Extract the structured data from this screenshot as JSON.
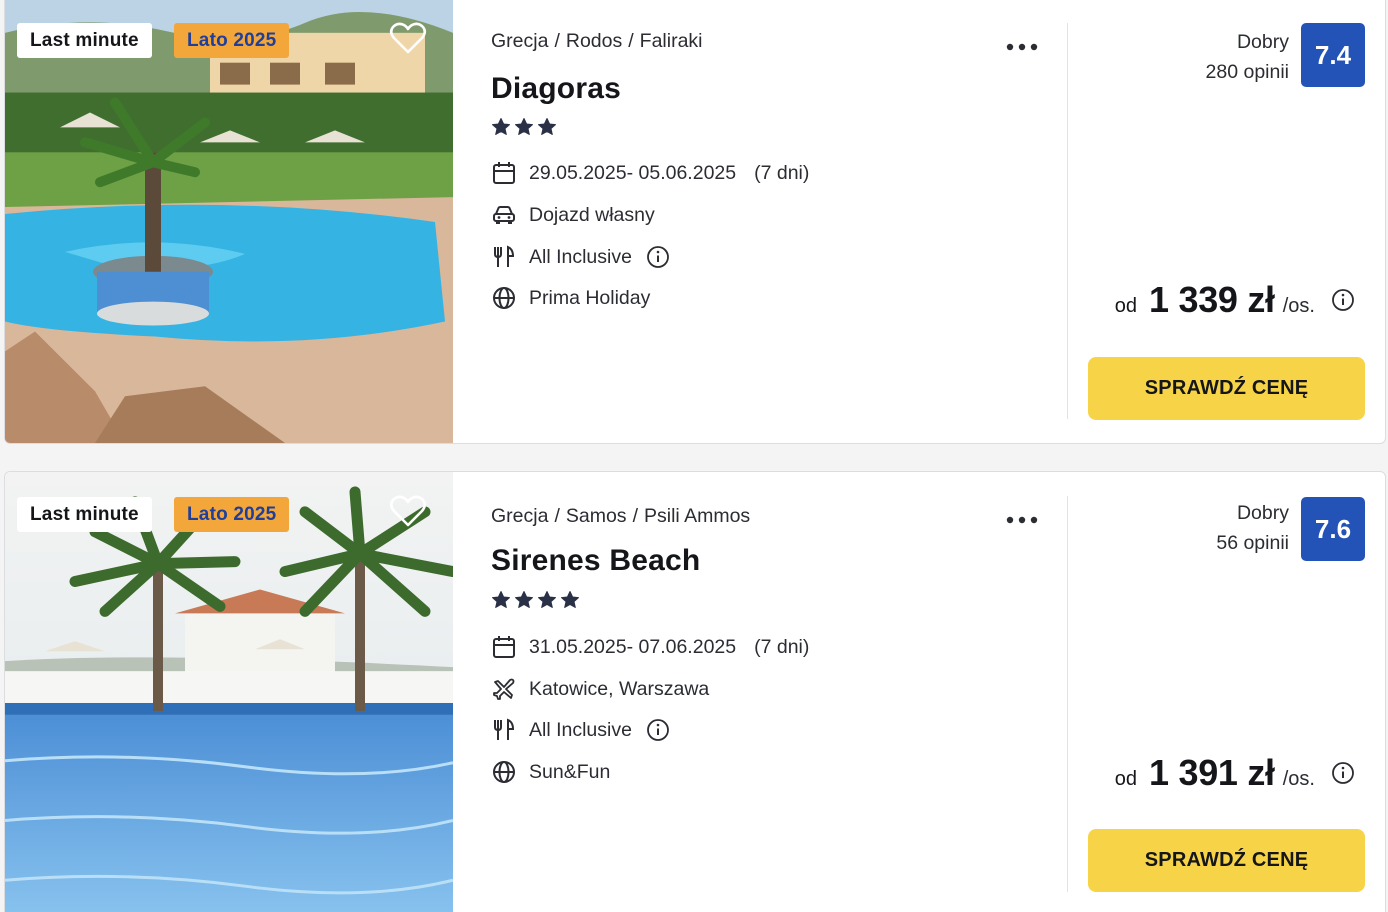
{
  "offers": [
    {
      "badges": {
        "last_minute": "Last minute",
        "season": "Lato 2025"
      },
      "breadcrumb": [
        "Grecja",
        "Rodos",
        "Faliraki"
      ],
      "breadcrumb_separator": "/",
      "name": "Diagoras",
      "stars": 3,
      "dates": "29.05.2025- 05.06.2025",
      "duration": "(7 dni)",
      "transport": "Dojazd własny",
      "transport_icon": "car-icon",
      "board": "All Inclusive",
      "operator": "Prima Holiday",
      "rating_label": "Dobry",
      "reviews": "280 opinii",
      "score": "7.4",
      "price_prefix": "od",
      "price": "1 339 zł",
      "price_unit": "/os.",
      "cta": "SPRAWDŹ CENĘ"
    },
    {
      "badges": {
        "last_minute": "Last minute",
        "season": "Lato 2025"
      },
      "breadcrumb": [
        "Grecja",
        "Samos",
        "Psili Ammos"
      ],
      "breadcrumb_separator": "/",
      "name": "Sirenes Beach",
      "stars": 4,
      "dates": "31.05.2025- 07.06.2025",
      "duration": "(7 dni)",
      "transport": "Katowice, Warszawa",
      "transport_icon": "plane-icon",
      "board": "All Inclusive",
      "operator": "Sun&Fun",
      "rating_label": "Dobry",
      "reviews": "56 opinii",
      "score": "7.6",
      "price_prefix": "od",
      "price": "1 391 zł",
      "price_unit": "/os.",
      "cta": "SPRAWDŹ CENĘ"
    }
  ],
  "colors": {
    "score_bg": "#2453b8",
    "cta_bg": "#f7d447",
    "season_badge_bg": "#f3a73a",
    "season_badge_text": "#1f3f9a",
    "star": "#2a3147"
  }
}
